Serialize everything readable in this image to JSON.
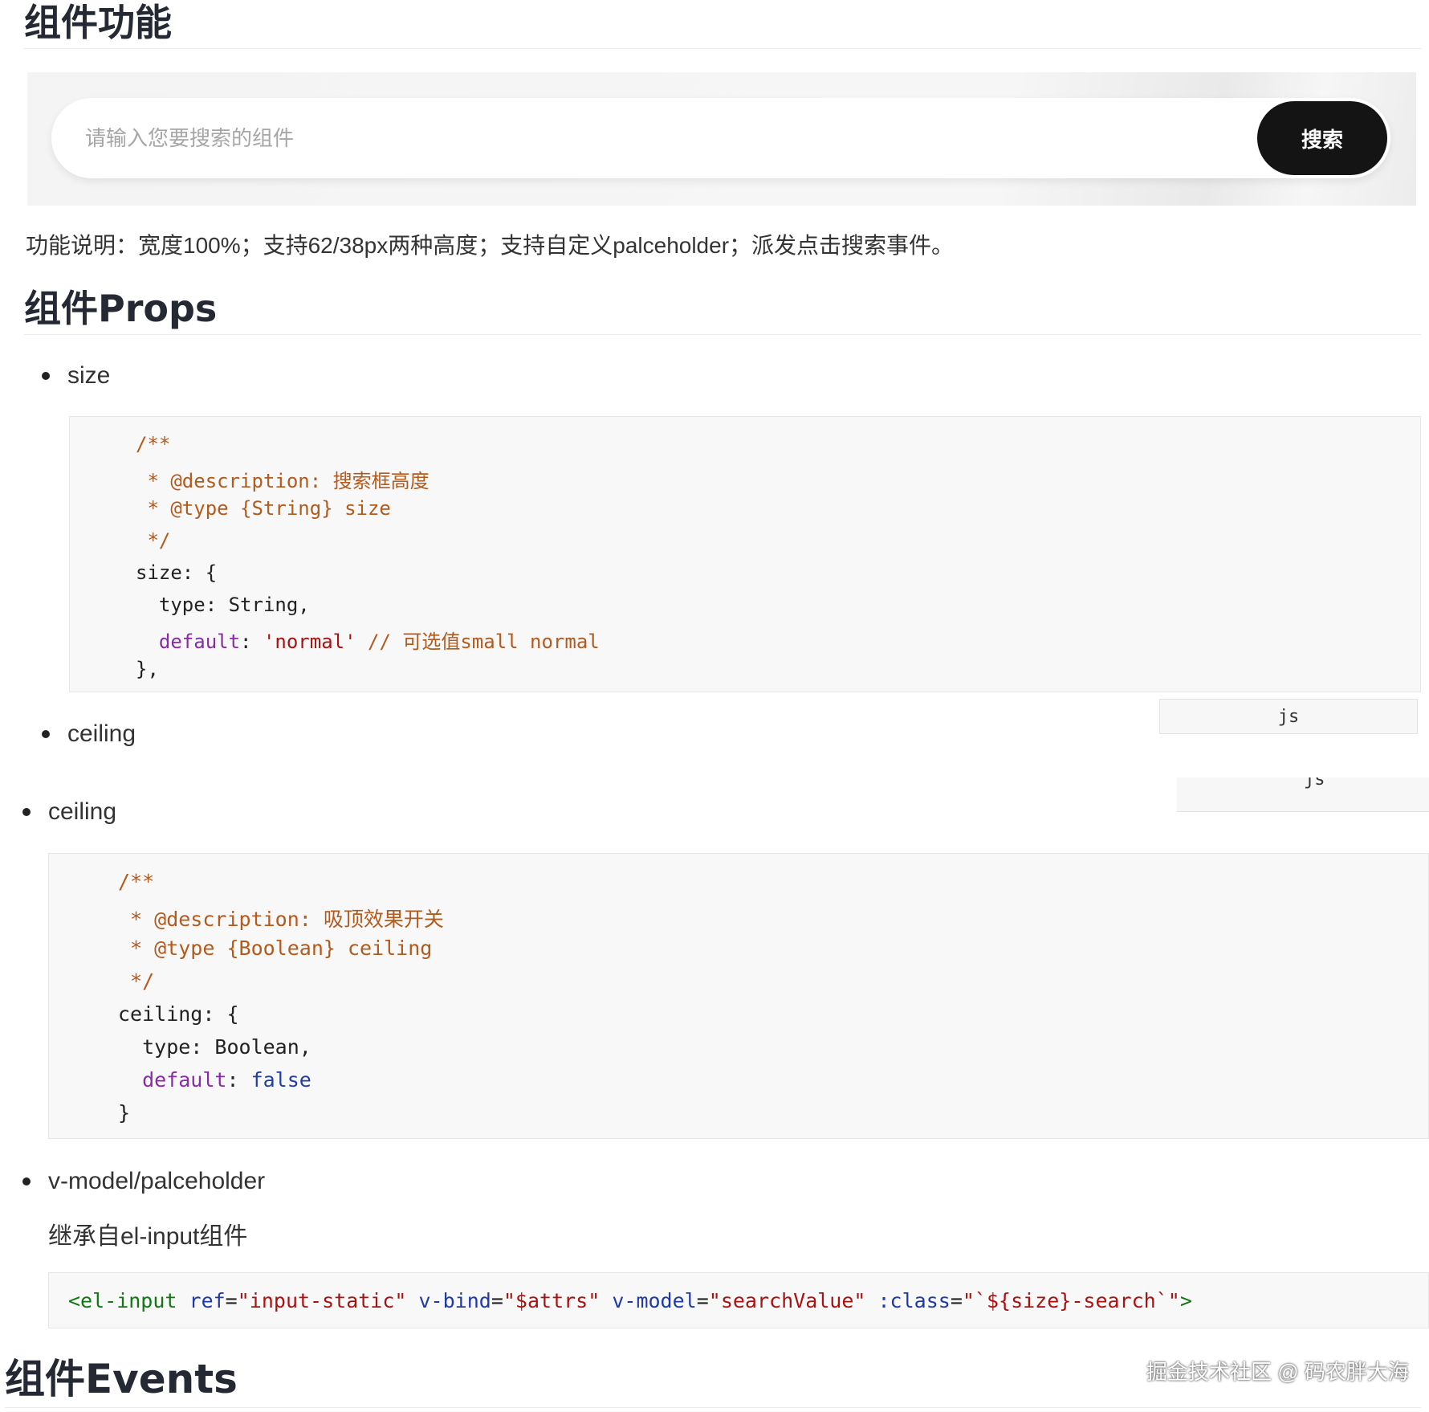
{
  "headings": {
    "function": "组件功能",
    "props": "组件Props",
    "events": "组件Events"
  },
  "search_demo": {
    "placeholder": "请输入您要搜索的组件",
    "button": "搜索"
  },
  "function_desc": "功能说明：宽度100%；支持62/38px两种高度；支持自定义palceholder；派发点击搜索事件。",
  "props": {
    "size": {
      "label": "size",
      "code": {
        "c1": "/**",
        "c2": " * @description: 搜索框高度",
        "c3": " * @type {String} size",
        "c4": " */",
        "l5": "size: {",
        "l6": "  type: String,",
        "l7_key": "  default",
        "l7_colon": ": ",
        "l7_str": "'normal'",
        "l7_comment": " // 可选值small normal",
        "l8": "},"
      },
      "lang": "js"
    },
    "ceiling_ghost_label": "ceiling",
    "ceiling_ghost_lang": "js",
    "ceiling": {
      "label": "ceiling",
      "code": {
        "c1": "/**",
        "c2": " * @description: 吸顶效果开关",
        "c3": " * @type {Boolean} ceiling",
        "c4": " */",
        "l5": "ceiling: {",
        "l6": "  type: Boolean,",
        "l7_key": "  default",
        "l7_colon": ": ",
        "l7_val": "false",
        "l8": "}"
      }
    },
    "vmodel": {
      "label": "v-model/palceholder",
      "desc": "继承自el-input组件",
      "code": {
        "tag_open": "<el-input ",
        "a1": "ref",
        "v1": "\"input-static\"",
        "a2": " v-bind",
        "v2": "\"$attrs\"",
        "a3": " v-model",
        "v3": "\"searchValue\"",
        "a4": " :class",
        "v4": "\"`${size}-search`\"",
        "eq": "=",
        "tag_close": ">"
      }
    }
  },
  "watermark": "掘金技术社区 @ 码农胖大海",
  "colors": {
    "heading": "#252933",
    "code_bg": "#f8f8f8",
    "comment": "#b35a1d",
    "keyword": "#8a2aa8",
    "string": "#aa1111",
    "button_bg": "#141414"
  }
}
